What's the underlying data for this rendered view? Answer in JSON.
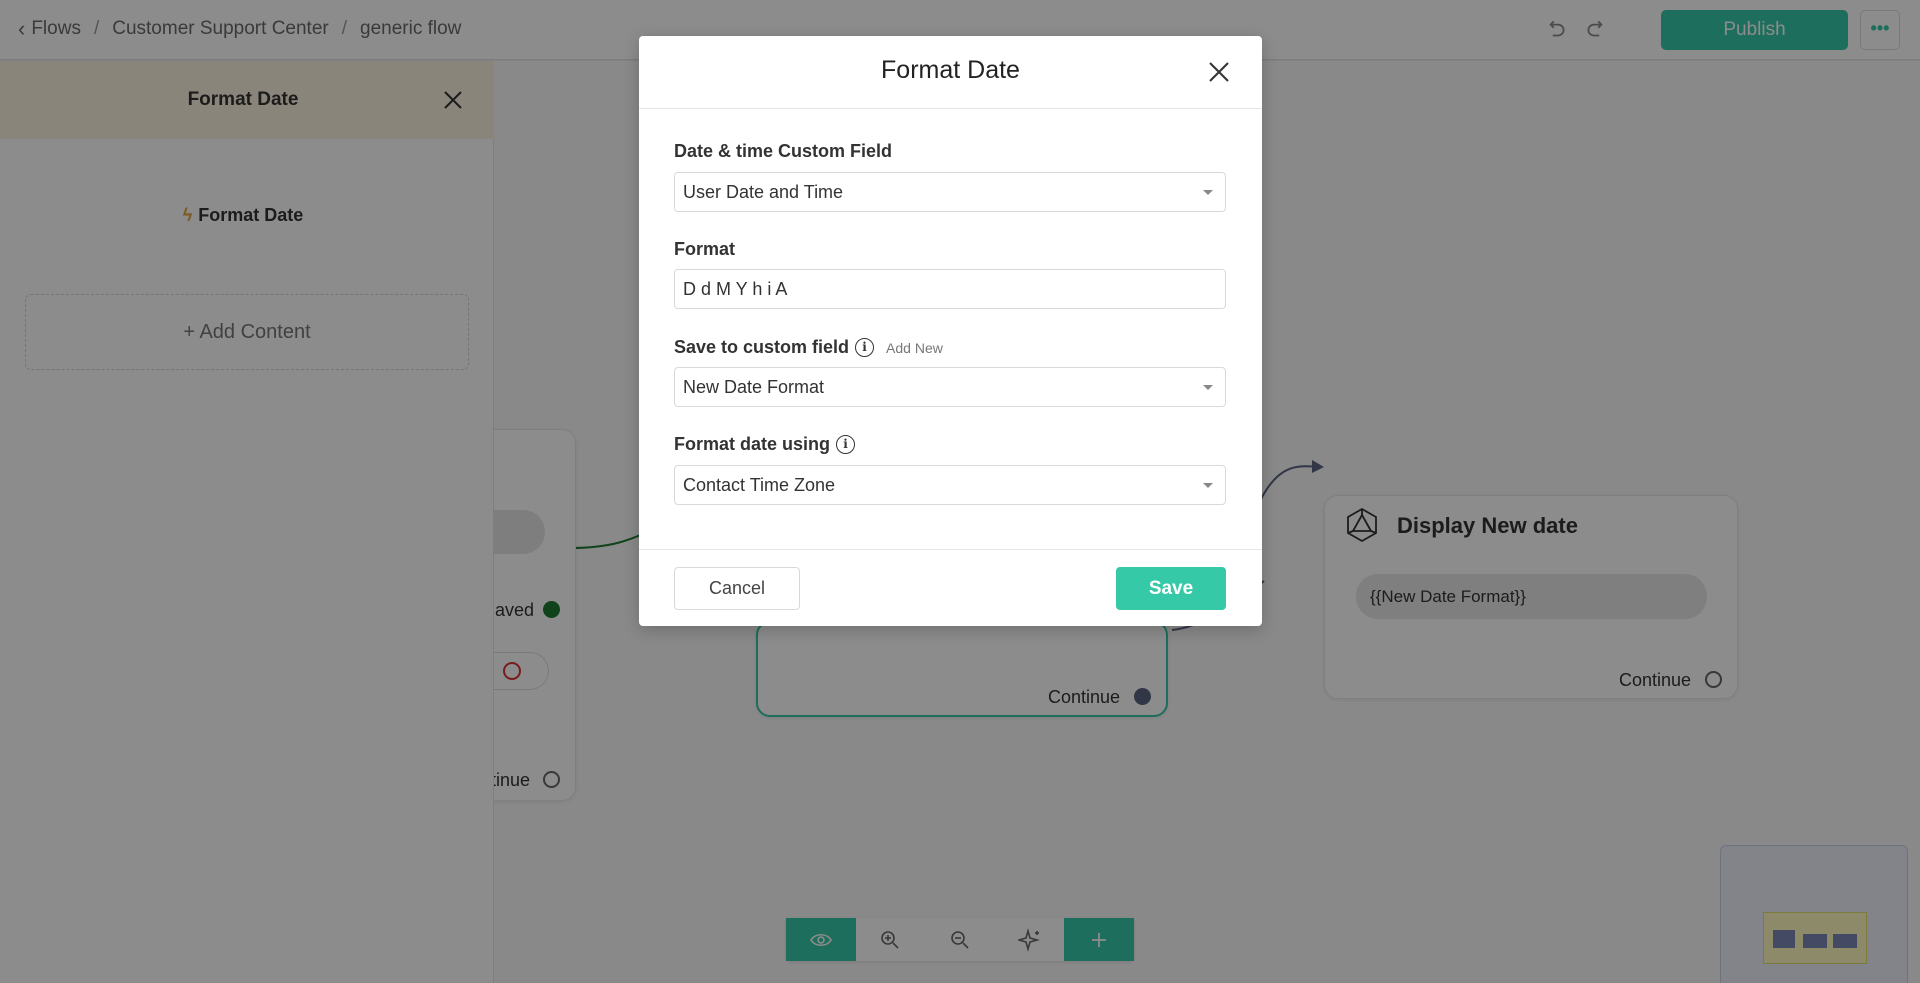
{
  "breadcrumb": {
    "items": [
      "Flows",
      "Customer Support Center",
      "generic flow"
    ],
    "separator": "/"
  },
  "toolbar": {
    "publish_label": "Publish",
    "more_label": "•••",
    "undo_icon": "undo-icon",
    "redo_icon": "redo-icon"
  },
  "panel": {
    "title": "Format Date",
    "subtitle": "Format Date",
    "add_content_label": "Add Content"
  },
  "canvas": {
    "left_node": {
      "saved_label": "aved",
      "continue_label": "tinue"
    },
    "mid_node": {
      "continue_label": "Continue"
    },
    "display_node": {
      "title": "Display New date",
      "message": "{{New Date Format}}",
      "continue_label": "Continue"
    },
    "zoom_bar": [
      "eye-icon",
      "zoom-in-icon",
      "zoom-out-icon",
      "sparkle-icon",
      "plus-icon"
    ]
  },
  "modal": {
    "title": "Format Date",
    "fields": {
      "date_field_label": "Date & time Custom Field",
      "date_field_value": "User Date and Time",
      "format_label": "Format",
      "format_value": "D d M Y h i A",
      "save_to_label": "Save to custom field",
      "add_new_label": "Add New",
      "save_to_value": "New Date Format",
      "format_using_label": "Format date using",
      "format_using_value": "Contact Time Zone"
    },
    "cancel_label": "Cancel",
    "save_label": "Save"
  },
  "colors": {
    "accent": "#35c9a8",
    "panel_header": "#fbf2e1",
    "connector_green": "#1e7a2e"
  }
}
